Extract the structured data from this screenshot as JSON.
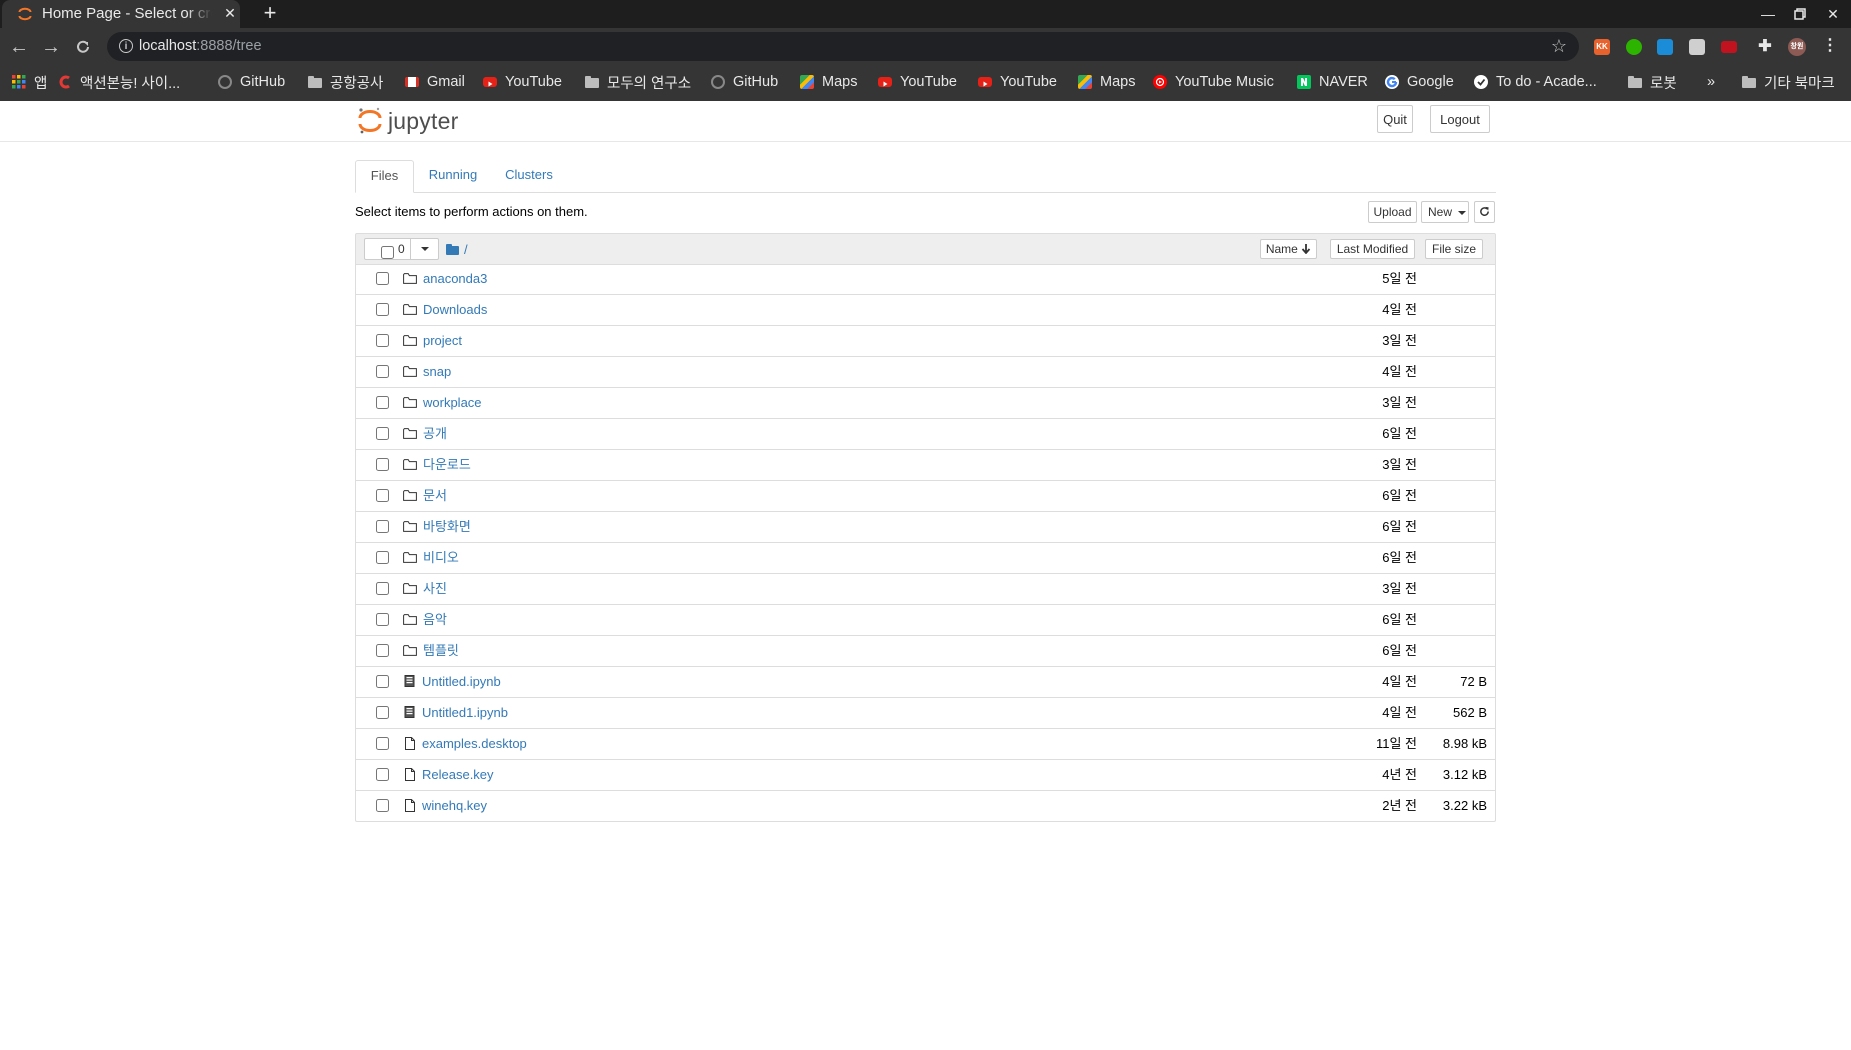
{
  "browser": {
    "tab_title": "Home Page - Select or create a notebook",
    "new_tab": "+",
    "url_host": "localhost",
    "url_path": ":8888/tree",
    "profile_label": "창원",
    "overflow": "»",
    "other_bookmarks": "기타 북마크"
  },
  "bookmarks": [
    {
      "label": "앱",
      "icon": "apps-grid-icon"
    },
    {
      "label": "액션본능! 사이...",
      "icon": "red-c-icon"
    },
    {
      "label": "GitHub",
      "icon": "github-icon"
    },
    {
      "label": "공항공사",
      "icon": "folder-icon"
    },
    {
      "label": "Gmail",
      "icon": "gmail-icon"
    },
    {
      "label": "YouTube",
      "icon": "youtube-icon"
    },
    {
      "label": "모두의 연구소",
      "icon": "folder-icon"
    },
    {
      "label": "GitHub",
      "icon": "github-icon"
    },
    {
      "label": "Maps",
      "icon": "maps-icon"
    },
    {
      "label": "YouTube",
      "icon": "youtube-icon"
    },
    {
      "label": "YouTube",
      "icon": "youtube-icon"
    },
    {
      "label": "Maps",
      "icon": "maps-icon"
    },
    {
      "label": "YouTube Music",
      "icon": "youtube-music-icon"
    },
    {
      "label": "NAVER",
      "icon": "naver-icon"
    },
    {
      "label": "Google",
      "icon": "google-icon"
    },
    {
      "label": "To do - Acade...",
      "icon": "todo-icon"
    },
    {
      "label": "로봇",
      "icon": "folder-icon"
    }
  ],
  "jupyter": {
    "brand": "jupyter",
    "quit": "Quit",
    "logout": "Logout",
    "tabs": [
      "Files",
      "Running",
      "Clusters"
    ],
    "hint": "Select items to perform actions on them.",
    "upload": "Upload",
    "new": "New",
    "selected_count": "0",
    "breadcrumb": "/",
    "col_name": "Name",
    "col_modified": "Last Modified",
    "col_size": "File size"
  },
  "colors": {
    "link": "#337ab7",
    "jupyter_orange": "#f37626",
    "chrome_dark": "#353535"
  },
  "files": [
    {
      "name": "anaconda3",
      "type": "folder",
      "modified": "5일 전",
      "size": ""
    },
    {
      "name": "Downloads",
      "type": "folder",
      "modified": "4일 전",
      "size": ""
    },
    {
      "name": "project",
      "type": "folder",
      "modified": "3일 전",
      "size": ""
    },
    {
      "name": "snap",
      "type": "folder",
      "modified": "4일 전",
      "size": ""
    },
    {
      "name": "workplace",
      "type": "folder",
      "modified": "3일 전",
      "size": ""
    },
    {
      "name": "공개",
      "type": "folder",
      "modified": "6일 전",
      "size": ""
    },
    {
      "name": "다운로드",
      "type": "folder",
      "modified": "3일 전",
      "size": ""
    },
    {
      "name": "문서",
      "type": "folder",
      "modified": "6일 전",
      "size": ""
    },
    {
      "name": "바탕화면",
      "type": "folder",
      "modified": "6일 전",
      "size": ""
    },
    {
      "name": "비디오",
      "type": "folder",
      "modified": "6일 전",
      "size": ""
    },
    {
      "name": "사진",
      "type": "folder",
      "modified": "3일 전",
      "size": ""
    },
    {
      "name": "음악",
      "type": "folder",
      "modified": "6일 전",
      "size": ""
    },
    {
      "name": "템플릿",
      "type": "folder",
      "modified": "6일 전",
      "size": ""
    },
    {
      "name": "Untitled.ipynb",
      "type": "notebook",
      "modified": "4일 전",
      "size": "72 B"
    },
    {
      "name": "Untitled1.ipynb",
      "type": "notebook",
      "modified": "4일 전",
      "size": "562 B"
    },
    {
      "name": "examples.desktop",
      "type": "file",
      "modified": "11일 전",
      "size": "8.98 kB"
    },
    {
      "name": "Release.key",
      "type": "file",
      "modified": "4년 전",
      "size": "3.12 kB"
    },
    {
      "name": "winehq.key",
      "type": "file",
      "modified": "2년 전",
      "size": "3.22 kB"
    }
  ]
}
